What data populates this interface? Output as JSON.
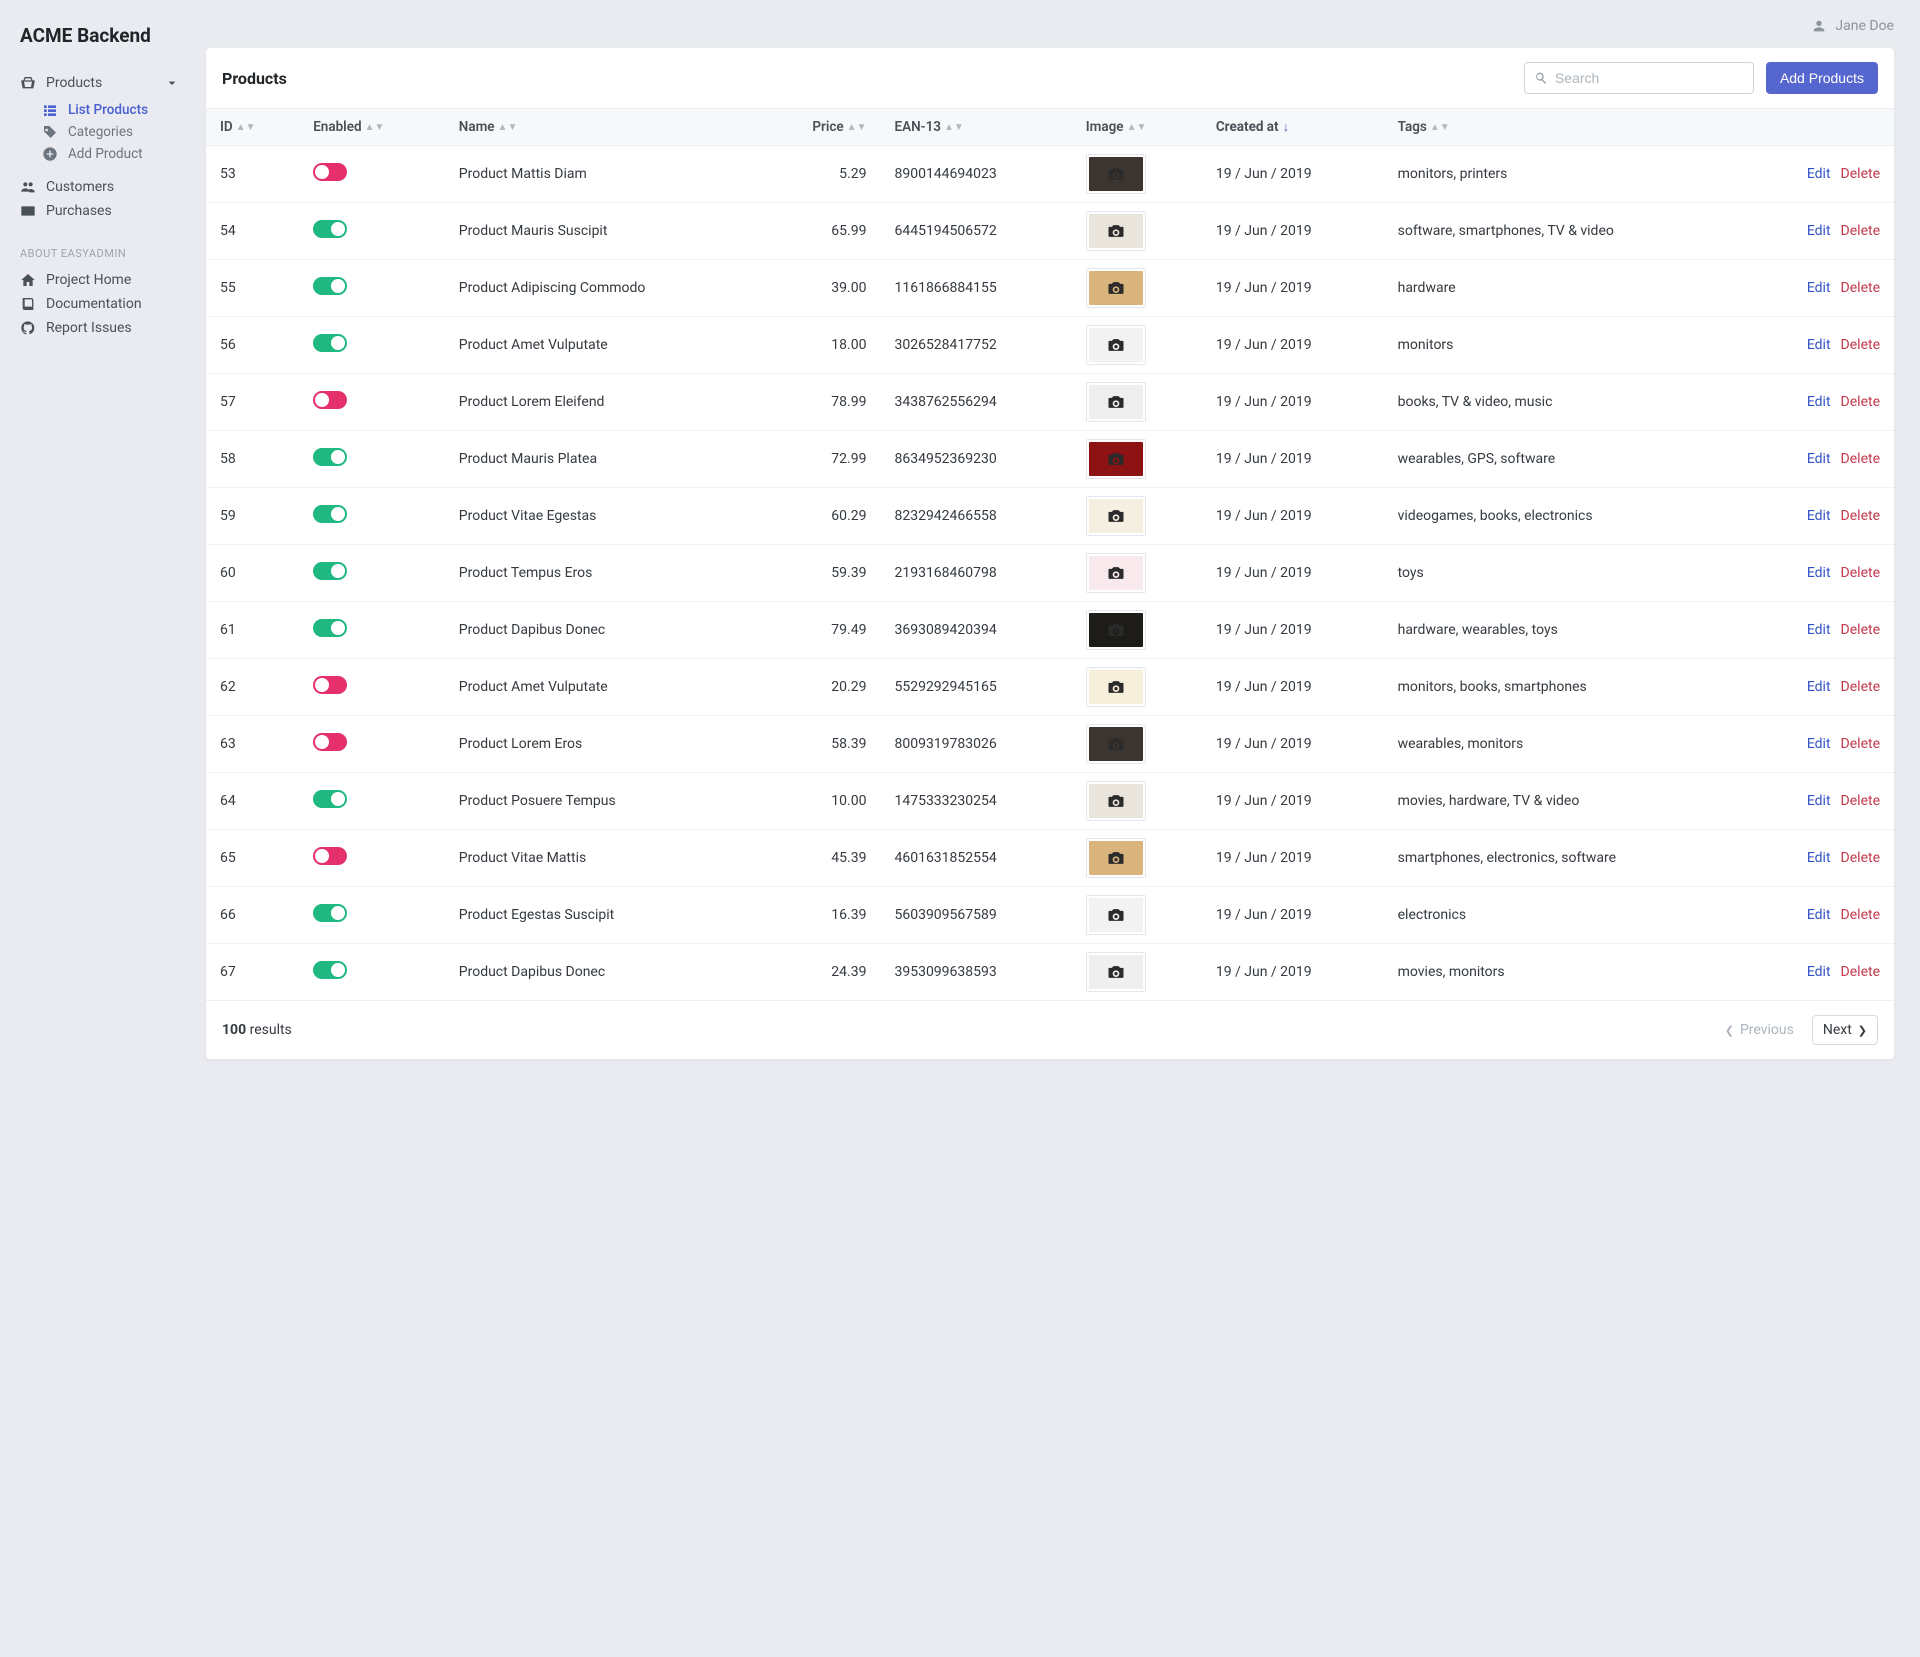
{
  "brand": "ACME Backend",
  "user": {
    "name": "Jane Doe"
  },
  "sidebar": {
    "products_label": "Products",
    "list_products": "List Products",
    "categories": "Categories",
    "add_product": "Add Product",
    "customers": "Customers",
    "purchases": "Purchases",
    "about_heading": "ABOUT EASYADMIN",
    "project_home": "Project Home",
    "documentation": "Documentation",
    "report_issues": "Report Issues"
  },
  "page": {
    "title": "Products",
    "search_placeholder": "Search",
    "add_button": "Add Products"
  },
  "columns": {
    "id": "ID",
    "enabled": "Enabled",
    "name": "Name",
    "price": "Price",
    "ean": "EAN-13",
    "image": "Image",
    "created": "Created at",
    "tags": "Tags"
  },
  "actions": {
    "edit": "Edit",
    "delete": "Delete"
  },
  "rows": [
    {
      "id": "53",
      "enabled": false,
      "name": "Product Mattis Diam",
      "price": "5.29",
      "ean": "8900144694023",
      "created": "19 / Jun / 2019",
      "tags": "monitors, printers",
      "thumb_bg": "#3c352f"
    },
    {
      "id": "54",
      "enabled": true,
      "name": "Product Mauris Suscipit",
      "price": "65.99",
      "ean": "6445194506572",
      "created": "19 / Jun / 2019",
      "tags": "software, smartphones, TV & video",
      "thumb_bg": "#e9e4dc"
    },
    {
      "id": "55",
      "enabled": true,
      "name": "Product Adipiscing Commodo",
      "price": "39.00",
      "ean": "1161866884155",
      "created": "19 / Jun / 2019",
      "tags": "hardware",
      "thumb_bg": "#d9b47c"
    },
    {
      "id": "56",
      "enabled": true,
      "name": "Product Amet Vulputate",
      "price": "18.00",
      "ean": "3026528417752",
      "created": "19 / Jun / 2019",
      "tags": "monitors",
      "thumb_bg": "#f2f2f2"
    },
    {
      "id": "57",
      "enabled": false,
      "name": "Product Lorem Eleifend",
      "price": "78.99",
      "ean": "3438762556294",
      "created": "19 / Jun / 2019",
      "tags": "books, TV & video, music",
      "thumb_bg": "#efefef"
    },
    {
      "id": "58",
      "enabled": true,
      "name": "Product Mauris Platea",
      "price": "72.99",
      "ean": "8634952369230",
      "created": "19 / Jun / 2019",
      "tags": "wearables, GPS, software",
      "thumb_bg": "#8d1213"
    },
    {
      "id": "59",
      "enabled": true,
      "name": "Product Vitae Egestas",
      "price": "60.29",
      "ean": "8232942466558",
      "created": "19 / Jun / 2019",
      "tags": "videogames, books, electronics",
      "thumb_bg": "#f5efe1"
    },
    {
      "id": "60",
      "enabled": true,
      "name": "Product Tempus Eros",
      "price": "59.39",
      "ean": "2193168460798",
      "created": "19 / Jun / 2019",
      "tags": "toys",
      "thumb_bg": "#f7e9ec"
    },
    {
      "id": "61",
      "enabled": true,
      "name": "Product Dapibus Donec",
      "price": "79.49",
      "ean": "3693089420394",
      "created": "19 / Jun / 2019",
      "tags": "hardware, wearables, toys",
      "thumb_bg": "#1d1c18"
    },
    {
      "id": "62",
      "enabled": false,
      "name": "Product Amet Vulputate",
      "price": "20.29",
      "ean": "5529292945165",
      "created": "19 / Jun / 2019",
      "tags": "monitors, books, smartphones",
      "thumb_bg": "#f6efda"
    },
    {
      "id": "63",
      "enabled": false,
      "name": "Product Lorem Eros",
      "price": "58.39",
      "ean": "8009319783026",
      "created": "19 / Jun / 2019",
      "tags": "wearables, monitors",
      "thumb_bg": "#3c352f"
    },
    {
      "id": "64",
      "enabled": true,
      "name": "Product Posuere Tempus",
      "price": "10.00",
      "ean": "1475333230254",
      "created": "19 / Jun / 2019",
      "tags": "movies, hardware, TV & video",
      "thumb_bg": "#e9e4dc"
    },
    {
      "id": "65",
      "enabled": false,
      "name": "Product Vitae Mattis",
      "price": "45.39",
      "ean": "4601631852554",
      "created": "19 / Jun / 2019",
      "tags": "smartphones, electronics, software",
      "thumb_bg": "#d9b47c"
    },
    {
      "id": "66",
      "enabled": true,
      "name": "Product Egestas Suscipit",
      "price": "16.39",
      "ean": "5603909567589",
      "created": "19 / Jun / 2019",
      "tags": "electronics",
      "thumb_bg": "#f2f2f2"
    },
    {
      "id": "67",
      "enabled": true,
      "name": "Product Dapibus Donec",
      "price": "24.39",
      "ean": "3953099638593",
      "created": "19 / Jun / 2019",
      "tags": "movies, monitors",
      "thumb_bg": "#efefef"
    }
  ],
  "footer": {
    "count": "100",
    "results_label": "results",
    "previous": "Previous",
    "next": "Next"
  }
}
